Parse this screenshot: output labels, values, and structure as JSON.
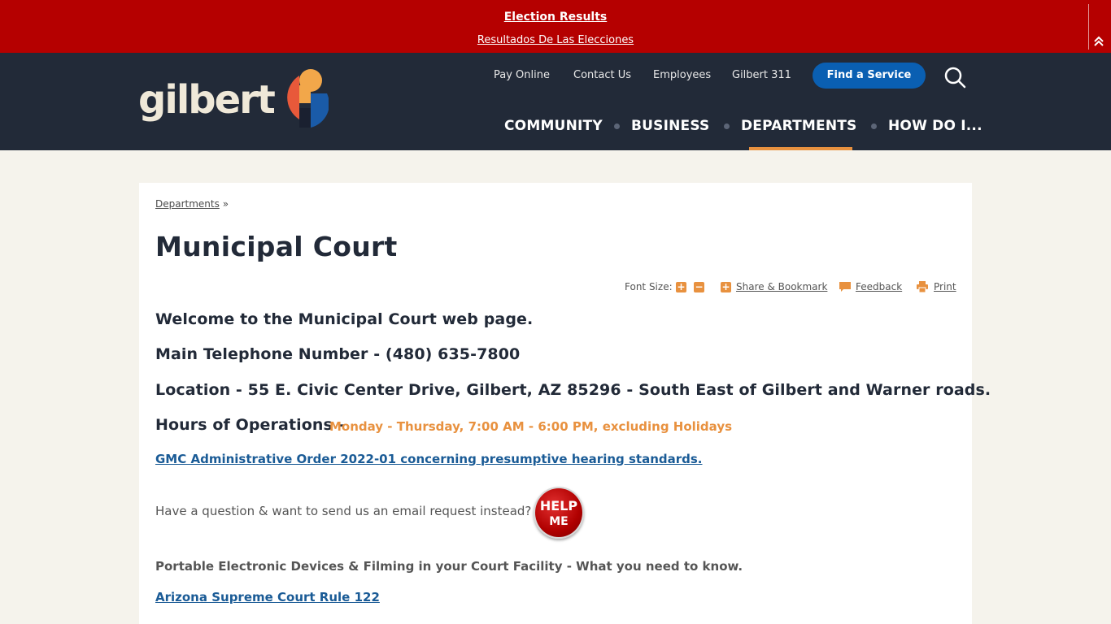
{
  "alert": {
    "title": "Election Results",
    "subtitle": "Resultados De Las Elecciones",
    "collapse_icon": "double-chevron-up-icon"
  },
  "header": {
    "logo_text": "gilbert",
    "utility_nav": [
      "Pay Online",
      "Contact Us",
      "Employees",
      "Gilbert 311"
    ],
    "find_service": "Find a Service",
    "search_icon": "search-icon",
    "main_nav": [
      "COMMUNITY",
      "BUSINESS",
      "DEPARTMENTS",
      "HOW DO I..."
    ],
    "active_nav": "DEPARTMENTS",
    "colors": {
      "header_bg": "#222a38",
      "alert_bg": "#b50000",
      "accent": "#e8913f",
      "button": "#0a5fb2"
    }
  },
  "content": {
    "breadcrumb": "Departments",
    "breadcrumb_sep": "»",
    "title": "Municipal Court",
    "tools": {
      "font_size_label": "Font Size:",
      "share": "Share & Bookmark",
      "feedback": "Feedback",
      "print": "Print"
    },
    "welcome": "Welcome to the Municipal Court web page.",
    "phone": "Main Telephone Number - (480) 635-7800",
    "location": "Location - 55 E. Civic Center Drive, Gilbert, AZ 85296 - South East of Gilbert and Warner roads.",
    "hours_label": "Hours of Operations -",
    "hours_detail": "Monday - Thursday, 7:00 AM - 6:00 PM, excluding Holidays",
    "admin_order_link": "GMC Administrative Order 2022-01 concerning presumptive hearing standards.",
    "question": "Have a question & want to send us an email request instead?",
    "help_top": "HELP",
    "help_bottom": "ME",
    "portable": "Portable Electronic Devices & Filming in your Court Facility - What you need to know.",
    "rule_link": "Arizona Supreme Court Rule 122"
  }
}
